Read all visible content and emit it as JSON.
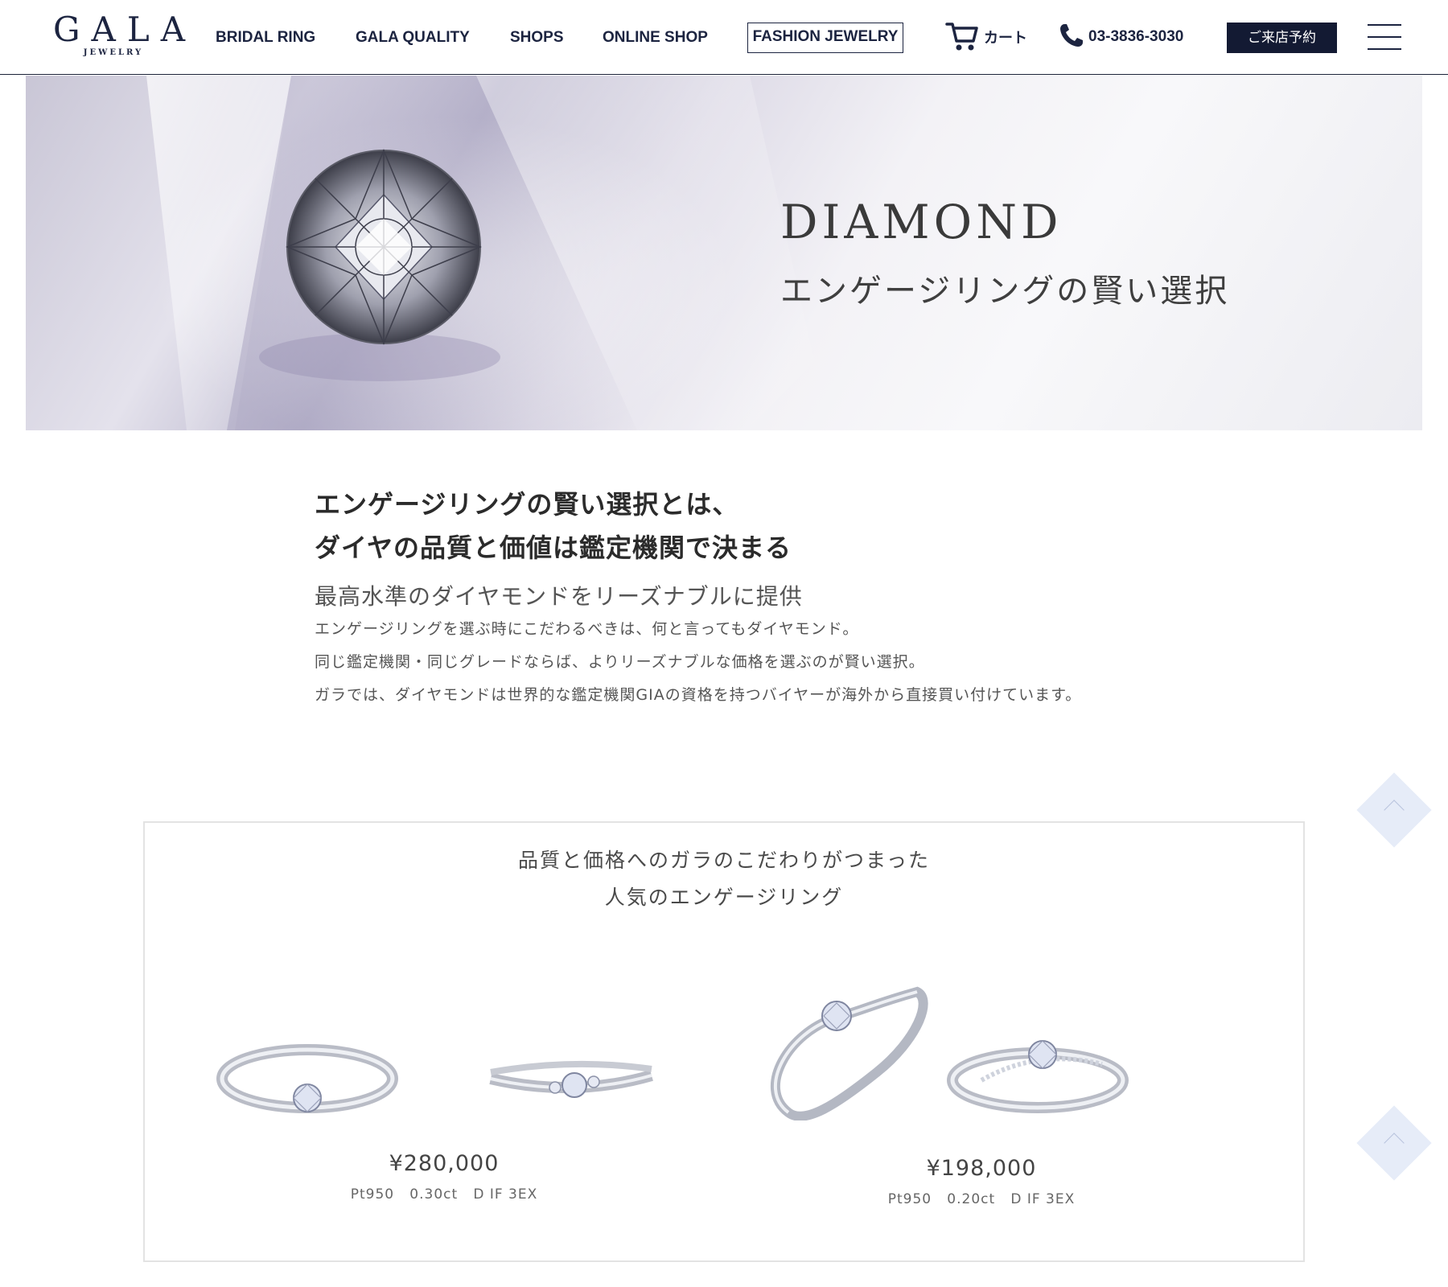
{
  "header": {
    "logo_main": "GALA",
    "logo_sub": "JEWELRY",
    "nav": [
      {
        "label": "BRIDAL RING"
      },
      {
        "label": "GALA QUALITY"
      },
      {
        "label": "SHOPS"
      },
      {
        "label": "ONLINE SHOP"
      }
    ],
    "fashion_label": "FASHION JEWELRY",
    "cart_label": "カート",
    "phone": "03-3836-3030",
    "reserve_label": "ご来店予約"
  },
  "hero": {
    "title": "DIAMOND",
    "subtitle": "エンゲージリングの賢い選択"
  },
  "intro": {
    "heading_line1": "エンゲージリングの賢い選択とは、",
    "heading_line2": "ダイヤの品質と価値は鑑定機関で決まる",
    "lead": "最高水準のダイヤモンドをリーズナブルに提供",
    "paragraphs": [
      "エンゲージリングを選ぶ時にこだわるべきは、何と言ってもダイヤモンド。",
      "同じ鑑定機関・同じグレードならば、よりリーズナブルな価格を選ぶのが賢い選択。",
      "ガラでは、ダイヤモンドは世界的な鑑定機関GIAの資格を持つバイヤーが海外から直接買い付けています。"
    ]
  },
  "feature": {
    "title_line1": "品質と価格へのガラのこだわりがつまった",
    "title_line2": "人気のエンゲージリング",
    "products": [
      {
        "price": "¥280,000",
        "spec": "Pt950   0.30ct   D IF 3EX"
      },
      {
        "price": "¥198,000",
        "spec": "Pt950   0.20ct   D IF 3EX"
      }
    ]
  },
  "colors": {
    "navy": "#1c2440",
    "reserve_bg": "#131a33",
    "scroll_btn": "#e6ecf8"
  }
}
